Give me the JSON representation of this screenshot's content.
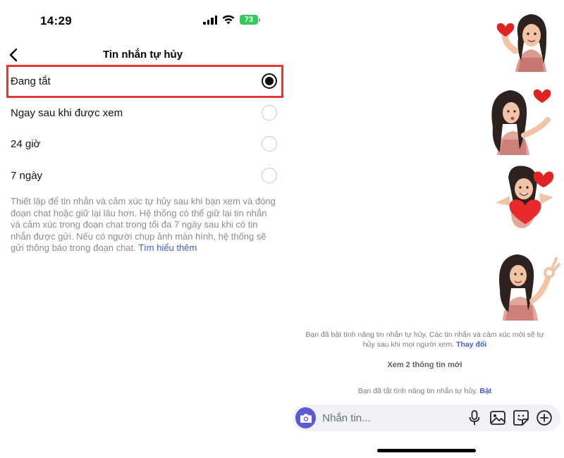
{
  "status_bar": {
    "time": "14:29",
    "battery": "73"
  },
  "header": {
    "title": "Tin nhắn tự hủy"
  },
  "options": [
    {
      "label": "Đang tắt",
      "selected": true
    },
    {
      "label": "Ngay sau khi được xem",
      "selected": false
    },
    {
      "label": "24 giờ",
      "selected": false
    },
    {
      "label": "7 ngày",
      "selected": false
    }
  ],
  "description": {
    "text": "Thiết lập để tin nhắn và cảm xúc tự hủy sau khi bạn xem và đóng đoạn chat hoặc giữ lại lâu hơn. Hệ thống có thể giữ lại tin nhắn và cảm xúc trong đoạn chat trong tối đa 7 ngày sau khi có tin nhắn được gửi. Nếu có người chụp ảnh màn hình, hệ thống sẽ gửi thông báo trong đoạn chat.",
    "link": "Tìm hiểu thêm"
  },
  "chat": {
    "stickers": [
      "heart-hands-avatar-sticker",
      "blow-kiss-avatar-sticker",
      "hearts-hug-avatar-sticker",
      "ok-sign-avatar-sticker"
    ],
    "enabled_notice": {
      "text": "Bạn đã bật tính năng tin nhắn tự hủy. Các tin nhắn và cảm xúc mới sẽ tự hủy sau khi mọi người xem.",
      "link": "Thay đổi"
    },
    "new_info": "Xem 2 thông tin mới",
    "disabled_notice": {
      "text": "Bạn đã tắt tính năng tin nhắn tự hủy.",
      "link": "Bật"
    }
  },
  "composer": {
    "placeholder": "Nhắn tin...",
    "icons": [
      "camera-icon",
      "microphone-icon",
      "gallery-icon",
      "sticker-icon",
      "plus-icon"
    ],
    "camera_color": "#5b5bd6"
  },
  "colors": {
    "highlight": "#e53935",
    "link": "#3b5bdb",
    "battery": "#34c759"
  }
}
